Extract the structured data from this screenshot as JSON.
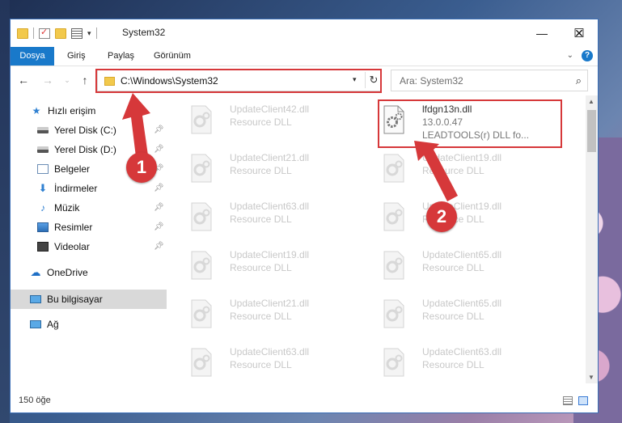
{
  "window": {
    "title": "System32",
    "controls": {
      "minimize": "—",
      "maximize": "☐",
      "close": "✕"
    }
  },
  "ribbon": {
    "tabs": [
      {
        "label": "Dosya"
      },
      {
        "label": "Giriş"
      },
      {
        "label": "Paylaş"
      },
      {
        "label": "Görünüm"
      }
    ],
    "help": "?"
  },
  "navbar": {
    "back": "←",
    "forward": "→",
    "up": "↑",
    "address": "C:\\Windows\\System32",
    "refresh": "↻",
    "search_placeholder": "Ara: System32"
  },
  "sidebar": {
    "items": [
      {
        "label": "Hızlı erişim",
        "icon": "star-icon"
      },
      {
        "label": "Yerel Disk (C:)",
        "icon": "drive-icon",
        "pinned": true
      },
      {
        "label": "Yerel Disk (D:)",
        "icon": "drive-icon",
        "pinned": true
      },
      {
        "label": "Belgeler",
        "icon": "documents-icon",
        "pinned": true
      },
      {
        "label": "İndirmeler",
        "icon": "downloads-icon",
        "pinned": true
      },
      {
        "label": "Müzik",
        "icon": "music-icon",
        "pinned": true
      },
      {
        "label": "Resimler",
        "icon": "pictures-icon",
        "pinned": true
      },
      {
        "label": "Videolar",
        "icon": "videos-icon",
        "pinned": true
      },
      {
        "label": "OneDrive",
        "icon": "cloud-icon"
      },
      {
        "label": "Bu bilgisayar",
        "icon": "computer-icon",
        "selected": true
      },
      {
        "label": "Ağ",
        "icon": "network-icon"
      }
    ]
  },
  "files": {
    "col1": [
      {
        "name": "UpdateClient42.dll",
        "type": "Resource DLL"
      },
      {
        "name": "UpdateClient21.dll",
        "type": "Resource DLL"
      },
      {
        "name": "UpdateClient63.dll",
        "type": "Resource DLL"
      },
      {
        "name": "UpdateClient19.dll",
        "type": "Resource DLL"
      },
      {
        "name": "UpdateClient21.dll",
        "type": "Resource DLL"
      },
      {
        "name": "UpdateClient63.dll",
        "type": "Resource DLL"
      }
    ],
    "highlighted": {
      "name": "lfdgn13n.dll",
      "version": "13.0.0.47",
      "description": "LEADTOOLS(r) DLL fo..."
    },
    "col2": [
      {
        "name": "UpdateClient19.dll",
        "type": "Resource DLL"
      },
      {
        "name": "UpdateClient19.dll",
        "type": "Resource DLL"
      },
      {
        "name": "UpdateClient65.dll",
        "type": "Resource DLL"
      },
      {
        "name": "UpdateClient65.dll",
        "type": "Resource DLL"
      },
      {
        "name": "UpdateClient63.dll",
        "type": "Resource DLL"
      }
    ]
  },
  "status": {
    "count": "150 öğe"
  },
  "annotations": {
    "marker1": "1",
    "marker2": "2",
    "color": "#d6383a"
  }
}
